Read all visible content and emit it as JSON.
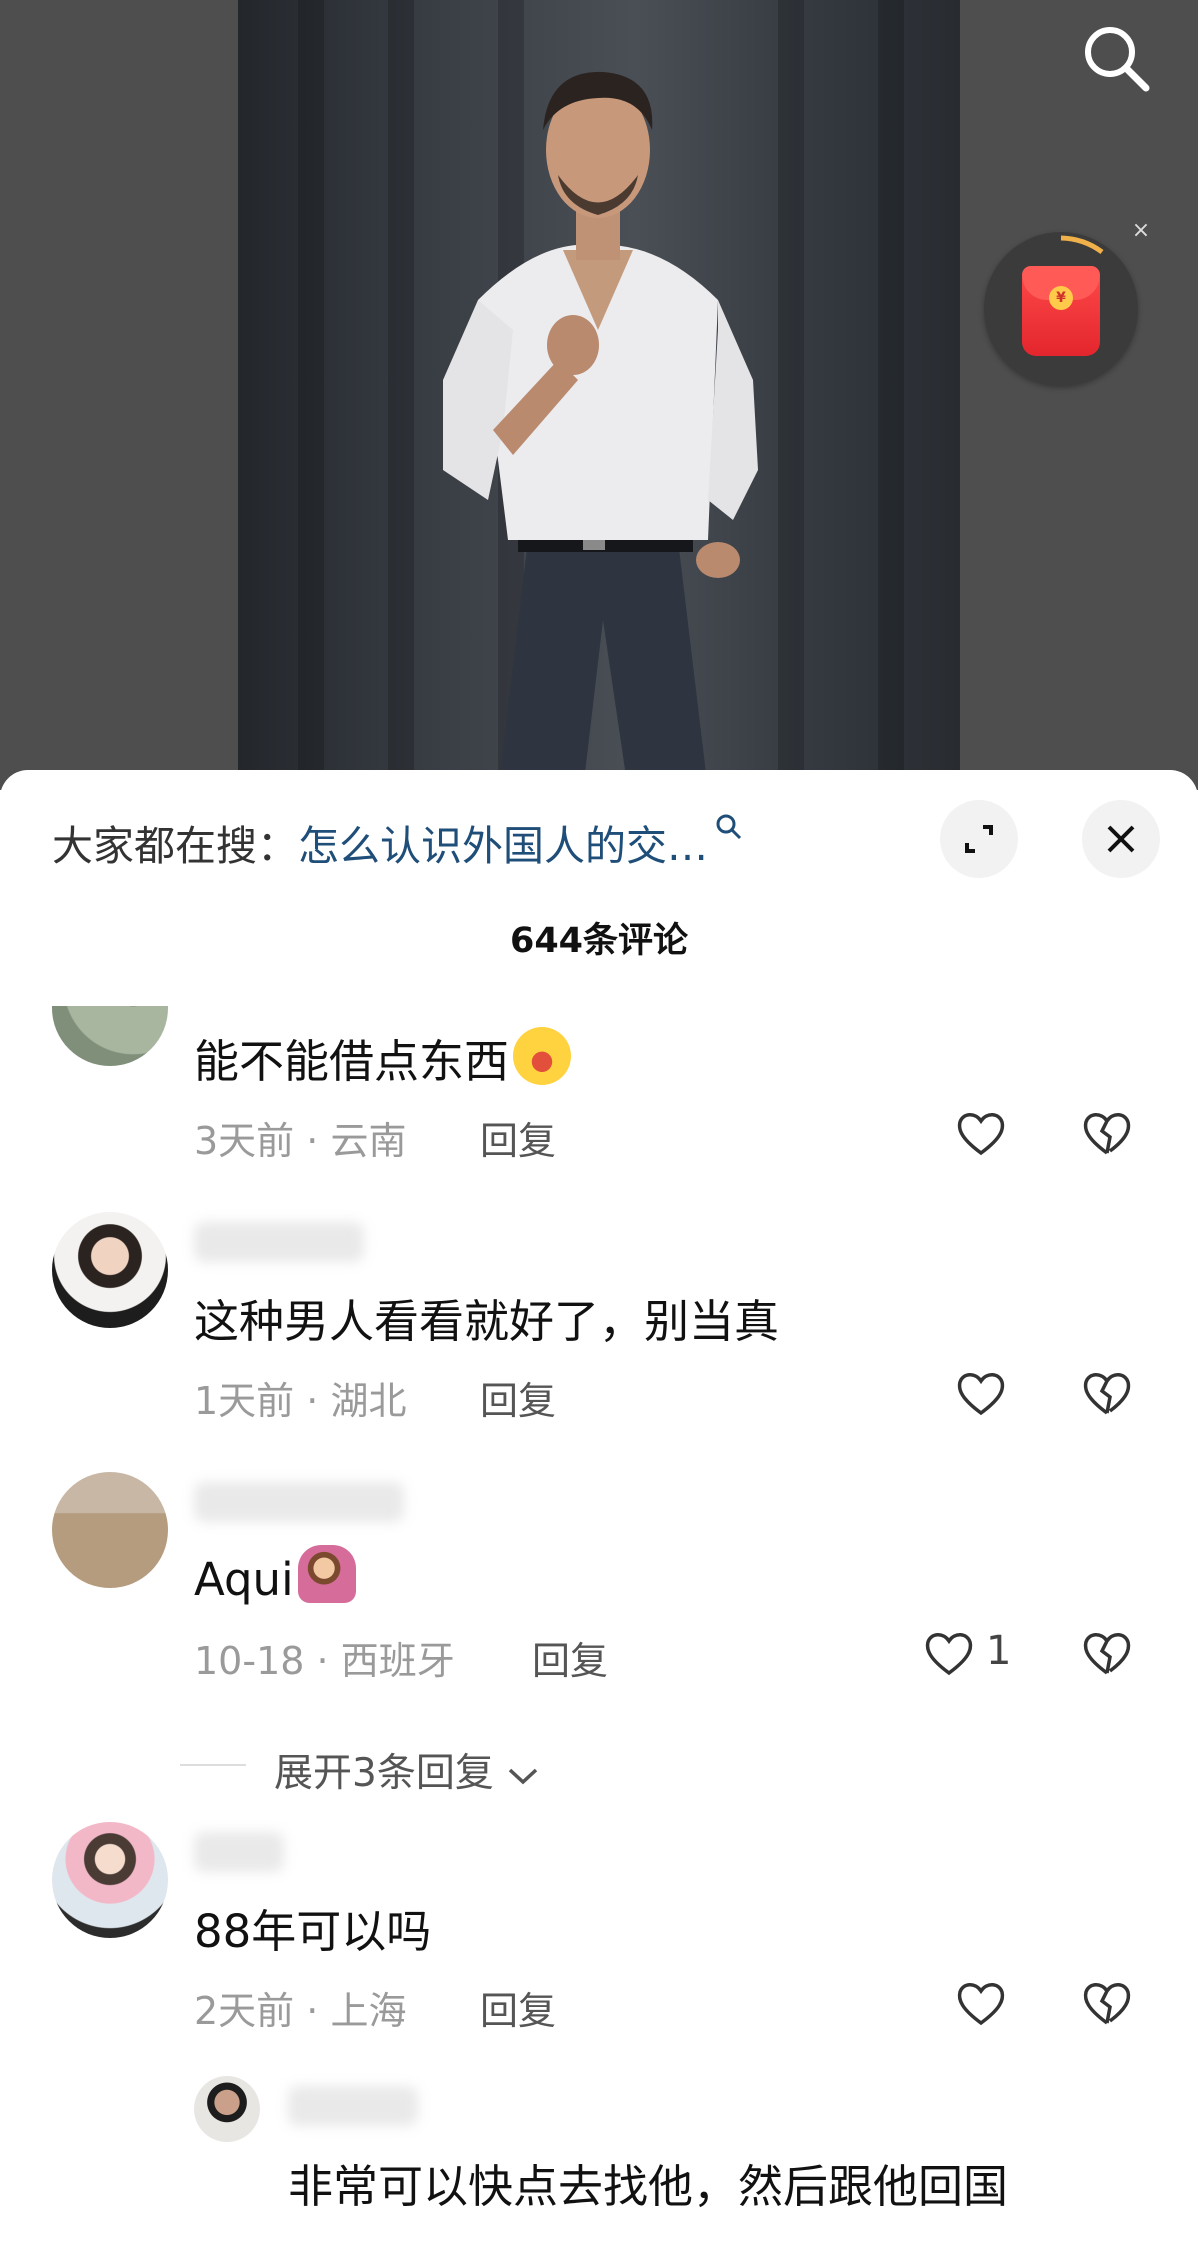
{
  "hot_search": {
    "prefix": "大家都在搜：",
    "query": "怎么认识外国人的交…"
  },
  "comments_title": "644条评论",
  "comments": [
    {
      "text": "能不能借点东西",
      "emoji": "laughing-crying-emoji",
      "time": "3天前",
      "location": "云南",
      "reply_label": "回复",
      "likes": ""
    },
    {
      "text": "这种男人看看就好了，别当真",
      "time": "1天前",
      "location": "湖北",
      "reply_label": "回复",
      "likes": ""
    },
    {
      "text": "Aqui",
      "emoji": "person-raising-hand-emoji",
      "time": "10-18",
      "location": "西班牙",
      "reply_label": "回复",
      "likes": "1"
    },
    {
      "text": "88年可以吗",
      "time": "2天前",
      "location": "上海",
      "reply_label": "回复",
      "likes": ""
    }
  ],
  "meta_separator": "·",
  "expand_replies": "展开3条回复",
  "sub_reply": {
    "text": "非常可以快点去找他，然后跟他回国"
  },
  "watermark": "",
  "colors": {
    "link": "#1f4e79",
    "meta": "#9a9a9a",
    "redpacket": "#e3262d"
  }
}
